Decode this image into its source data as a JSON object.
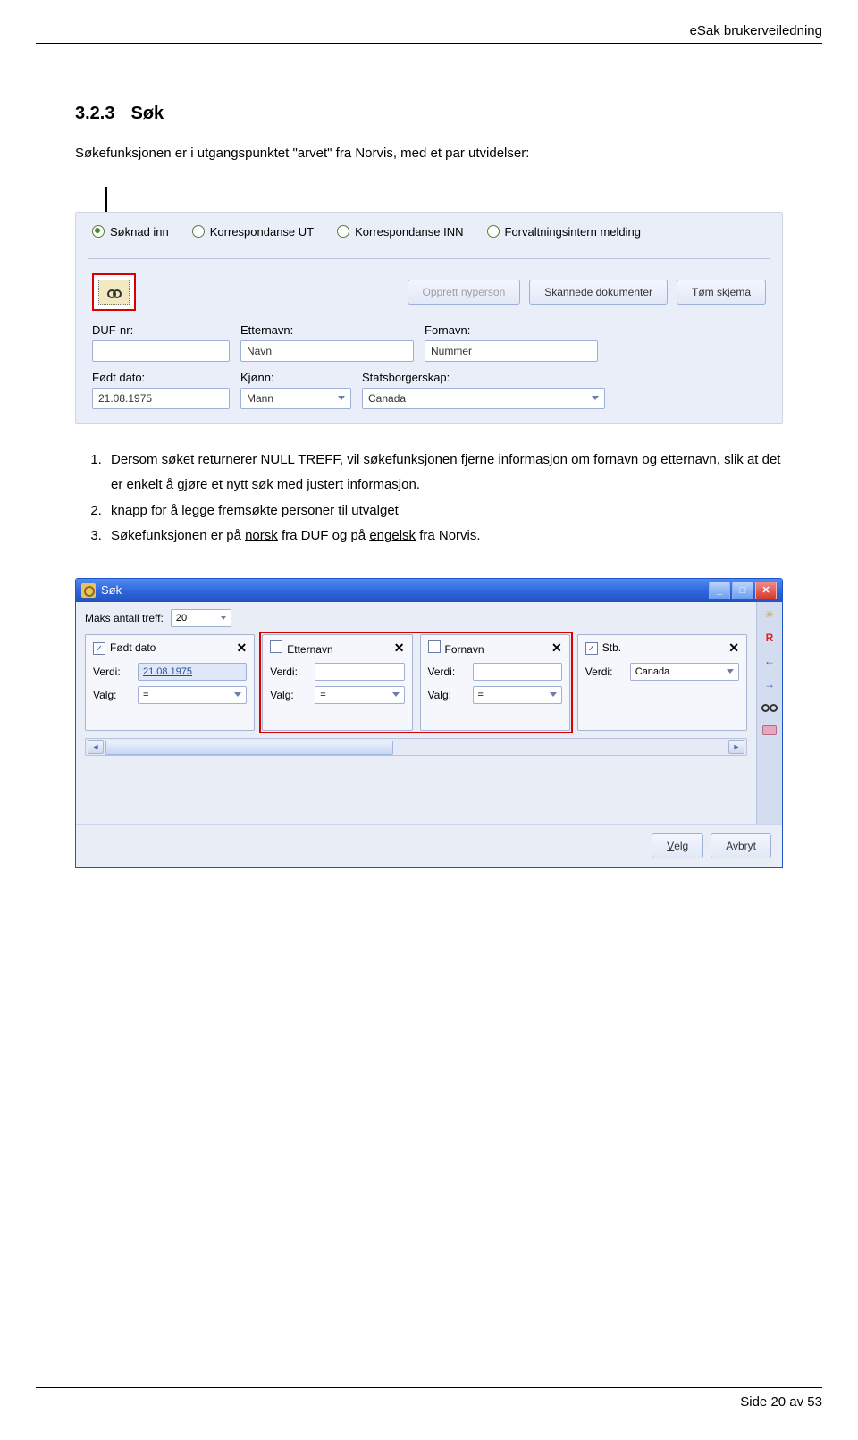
{
  "header": {
    "label": "eSak brukerveiledning"
  },
  "heading": {
    "number": "3.2.3",
    "title": "Søk"
  },
  "intro": "Søkefunksjonen er i utgangspunktet \"arvet\" fra Norvis, med et par utvidelser:",
  "panel": {
    "radios": [
      {
        "label": "Søknad inn",
        "checked": true
      },
      {
        "label": "Korrespondanse UT",
        "checked": false
      },
      {
        "label": "Korrespondanse INN",
        "checked": false
      },
      {
        "label": "Forvaltningsintern melding",
        "checked": false
      }
    ],
    "buttons": {
      "opprett": "Opprett ny person",
      "opprett_accel": "p",
      "skannede": "Skannede dokumenter",
      "tom": "Tøm skjema"
    },
    "fields": {
      "duf_label": "DUF-nr:",
      "duf_value": "",
      "etternavn_label": "Etternavn:",
      "etternavn_value": "Navn",
      "fornavn_label": "Fornavn:",
      "fornavn_value": "Nummer",
      "fodt_label": "Født dato:",
      "fodt_value": "21.08.1975",
      "kjonn_label": "Kjønn:",
      "kjonn_value": "Mann",
      "stats_label": "Statsborgerskap:",
      "stats_value": "Canada"
    }
  },
  "list": {
    "item1": "Dersom søket returnerer NULL TREFF, vil søkefunksjonen fjerne informasjon om fornavn og etternavn, slik at det er enkelt å gjøre et nytt søk med justert informasjon.",
    "item2": "knapp for å legge fremsøkte personer til utvalget",
    "item3_pre": "Søkefunksjonen er på ",
    "item3_u1": "norsk",
    "item3_mid": " fra DUF og på ",
    "item3_u2": "engelsk",
    "item3_post": " fra Norvis."
  },
  "sok": {
    "title": "Søk",
    "maks_label": "Maks antall treff:",
    "maks_value": "20",
    "criteria": [
      {
        "title": "Født dato",
        "checked": true,
        "verdi": "21.08.1975",
        "valg": "=",
        "date": true
      },
      {
        "title": "Etternavn",
        "checked": false,
        "verdi": "",
        "valg": "=",
        "date": false
      },
      {
        "title": "Fornavn",
        "checked": false,
        "verdi": "",
        "valg": "=",
        "date": false
      },
      {
        "title": "Stb.",
        "checked": true,
        "verdi": "Canada",
        "valg": "",
        "date": false,
        "combo": true
      }
    ],
    "row_labels": {
      "verdi": "Verdi:",
      "valg": "Valg:"
    },
    "side": {
      "r": "R"
    },
    "footer": {
      "velg": "Velg",
      "velg_accel": "V",
      "avbryt": "Avbryt"
    }
  },
  "footer": {
    "text": "Side 20 av 53"
  }
}
